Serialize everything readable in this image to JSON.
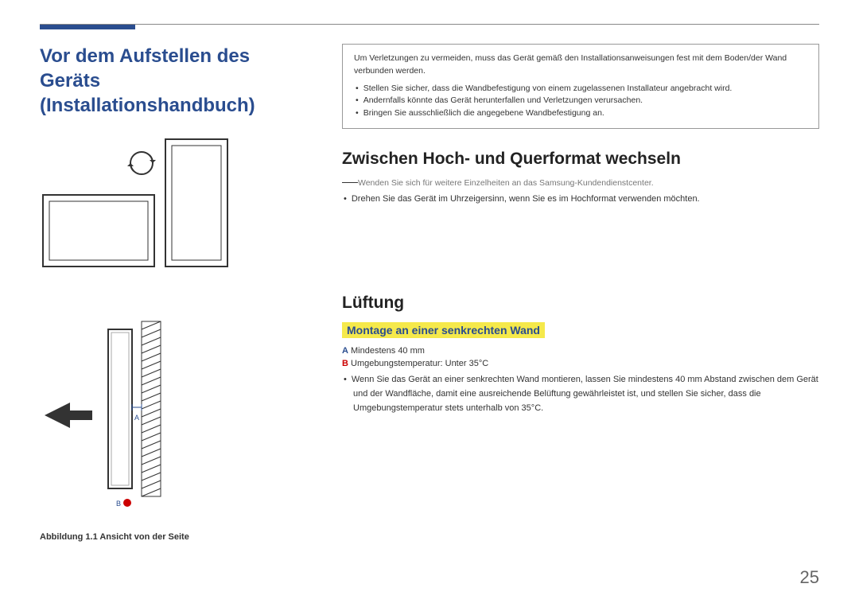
{
  "mainTitle": "Vor dem Aufstellen des Geräts (Installationshandbuch)",
  "infoBox": {
    "intro": "Um Verletzungen zu vermeiden, muss das Gerät gemäß den Installationsanweisungen fest mit dem Boden/der Wand verbunden werden.",
    "items": [
      "Stellen Sie sicher, dass die Wandbefestigung von einem zugelassenen Installateur angebracht wird.",
      "Andernfalls könnte das Gerät herunterfallen und Verletzungen verursachen.",
      "Bringen Sie ausschließlich die angegebene Wandbefestigung an."
    ]
  },
  "section1": {
    "heading": "Zwischen Hoch- und Querformat wechseln",
    "note": "Wenden Sie sich für weitere Einzelheiten an das Samsung-Kundendienstcenter.",
    "bullet": "Drehen Sie das Gerät im Uhrzeigersinn, wenn Sie es im Hochformat verwenden möchten."
  },
  "section2": {
    "heading": "Lüftung",
    "subheading": "Montage an einer senkrechten Wand",
    "specA": {
      "label": "A",
      "text": " Mindestens 40 mm"
    },
    "specB": {
      "label": "B",
      "text": " Umgebungstemperatur: Unter 35°C"
    },
    "bullet": "Wenn Sie das Gerät an einer senkrechten Wand montieren, lassen Sie mindestens 40 mm Abstand zwischen dem Gerät und der Wandfläche, damit eine ausreichende Belüftung gewährleistet ist, und stellen Sie sicher, dass die Umgebungstemperatur stets unterhalb von 35°C."
  },
  "diagram2": {
    "labelA": "A",
    "labelB": "B",
    "caption": "Abbildung 1.1 Ansicht von der Seite"
  },
  "pageNumber": "25"
}
